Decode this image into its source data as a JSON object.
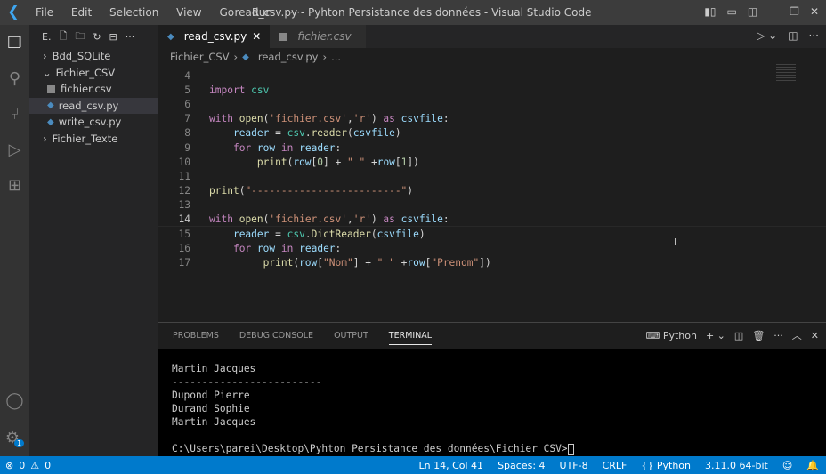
{
  "title": {
    "window_title": "read_csv.py - Pyhton Persistance des données - Visual Studio Code",
    "menu": [
      "File",
      "Edit",
      "Selection",
      "View",
      "Go",
      "Run",
      "···"
    ]
  },
  "sidebar": {
    "header": "E.",
    "tree": [
      {
        "label": "Bdd_SQLite",
        "type": "folder-closed"
      },
      {
        "label": "Fichier_CSV",
        "type": "folder-open"
      },
      {
        "label": "fichier.csv",
        "type": "csv"
      },
      {
        "label": "read_csv.py",
        "type": "py",
        "selected": true
      },
      {
        "label": "write_csv.py",
        "type": "py"
      },
      {
        "label": "Fichier_Texte",
        "type": "folder-closed"
      }
    ]
  },
  "tabs": [
    {
      "label": "read_csv.py",
      "active": true
    },
    {
      "label": "fichier.csv",
      "active": false
    }
  ],
  "breadcrumb": [
    "Fichier_CSV",
    "read_csv.py",
    "..."
  ],
  "editor": {
    "current_line": 14,
    "lines": [
      {
        "n": "4",
        "code": ""
      },
      {
        "n": "5",
        "code": "import csv"
      },
      {
        "n": "6",
        "code": ""
      },
      {
        "n": "7",
        "code": "with open('fichier.csv','r') as csvfile:"
      },
      {
        "n": "8",
        "code": "    reader = csv.reader(csvfile)"
      },
      {
        "n": "9",
        "code": "    for row in reader:"
      },
      {
        "n": "10",
        "code": "        print(row[0] + \" \" +row[1])"
      },
      {
        "n": "11",
        "code": ""
      },
      {
        "n": "12",
        "code": "print(\"-------------------------\")"
      },
      {
        "n": "13",
        "code": ""
      },
      {
        "n": "14",
        "code": "with open('fichier.csv','r') as csvfile:"
      },
      {
        "n": "15",
        "code": "    reader = csv.DictReader(csvfile)"
      },
      {
        "n": "16",
        "code": "    for row in reader:"
      },
      {
        "n": "17",
        "code": "         print(row[\"Nom\"] + \" \" +row[\"Prenom\"])"
      }
    ]
  },
  "panel": {
    "tabs": [
      "PROBLEMS",
      "DEBUG CONSOLE",
      "OUTPUT",
      "TERMINAL"
    ],
    "active_tab": "TERMINAL",
    "shell": "Python",
    "terminal_lines": [
      "Martin Jacques",
      "-------------------------",
      "Dupond Pierre",
      "Durand Sophie",
      "Martin Jacques",
      ""
    ],
    "prompt": "C:\\Users\\parei\\Desktop\\Pyhton Persistance des données\\Fichier_CSV>"
  },
  "status": {
    "errors": "0",
    "warnings": "0",
    "position": "Ln 14, Col 41",
    "spaces": "Spaces: 4",
    "encoding": "UTF-8",
    "eol": "CRLF",
    "language": "Python",
    "interpreter": "3.11.0 64-bit",
    "settings_badge": "1"
  },
  "colors": {
    "status_bar": "#007acc",
    "title_bar": "#3c3c3c",
    "editor_bg": "#1e1e1e"
  }
}
